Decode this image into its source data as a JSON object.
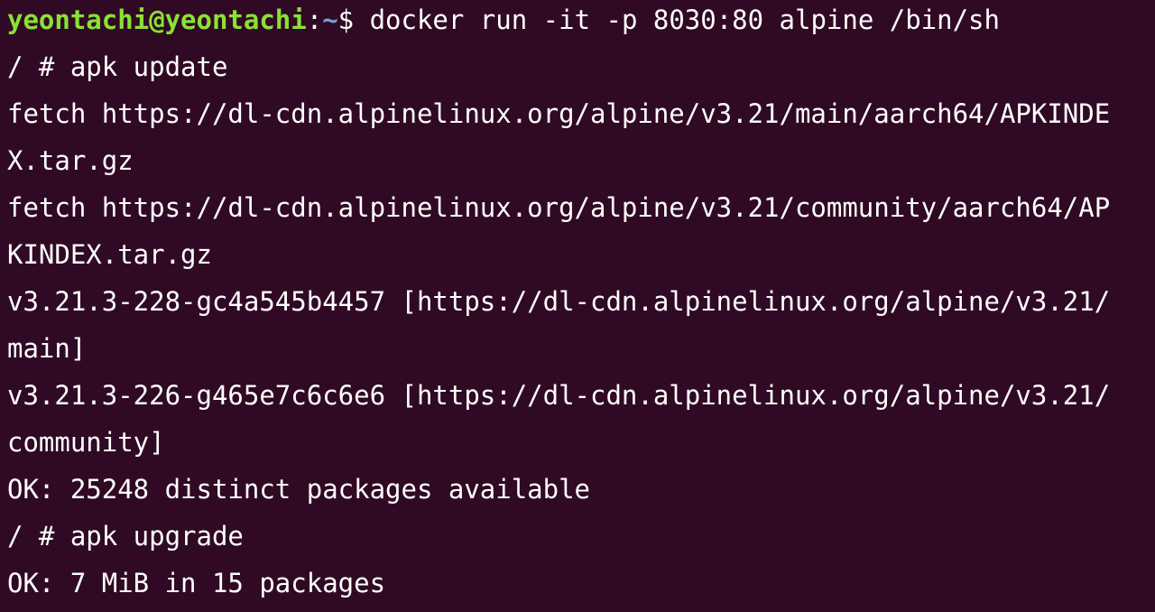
{
  "prompt": {
    "user_host": "yeontachi@yeontachi",
    "separator": ":",
    "cwd": "~",
    "symbol": "$ ",
    "command": "docker run -it -p 8030:80 alpine /bin/sh"
  },
  "lines": [
    "/ # apk update",
    "fetch https://dl-cdn.alpinelinux.org/alpine/v3.21/main/aarch64/APKINDE",
    "X.tar.gz",
    "fetch https://dl-cdn.alpinelinux.org/alpine/v3.21/community/aarch64/AP",
    "KINDEX.tar.gz",
    "v3.21.3-228-gc4a545b4457 [https://dl-cdn.alpinelinux.org/alpine/v3.21/",
    "main]",
    "v3.21.3-226-g465e7c6c6e6 [https://dl-cdn.alpinelinux.org/alpine/v3.21/",
    "community]",
    "OK: 25248 distinct packages available",
    "/ # apk upgrade",
    "OK: 7 MiB in 15 packages"
  ],
  "colors": {
    "background": "#300a24",
    "text": "#ffffff",
    "user_host": "#8ae234",
    "path": "#729fcf"
  }
}
